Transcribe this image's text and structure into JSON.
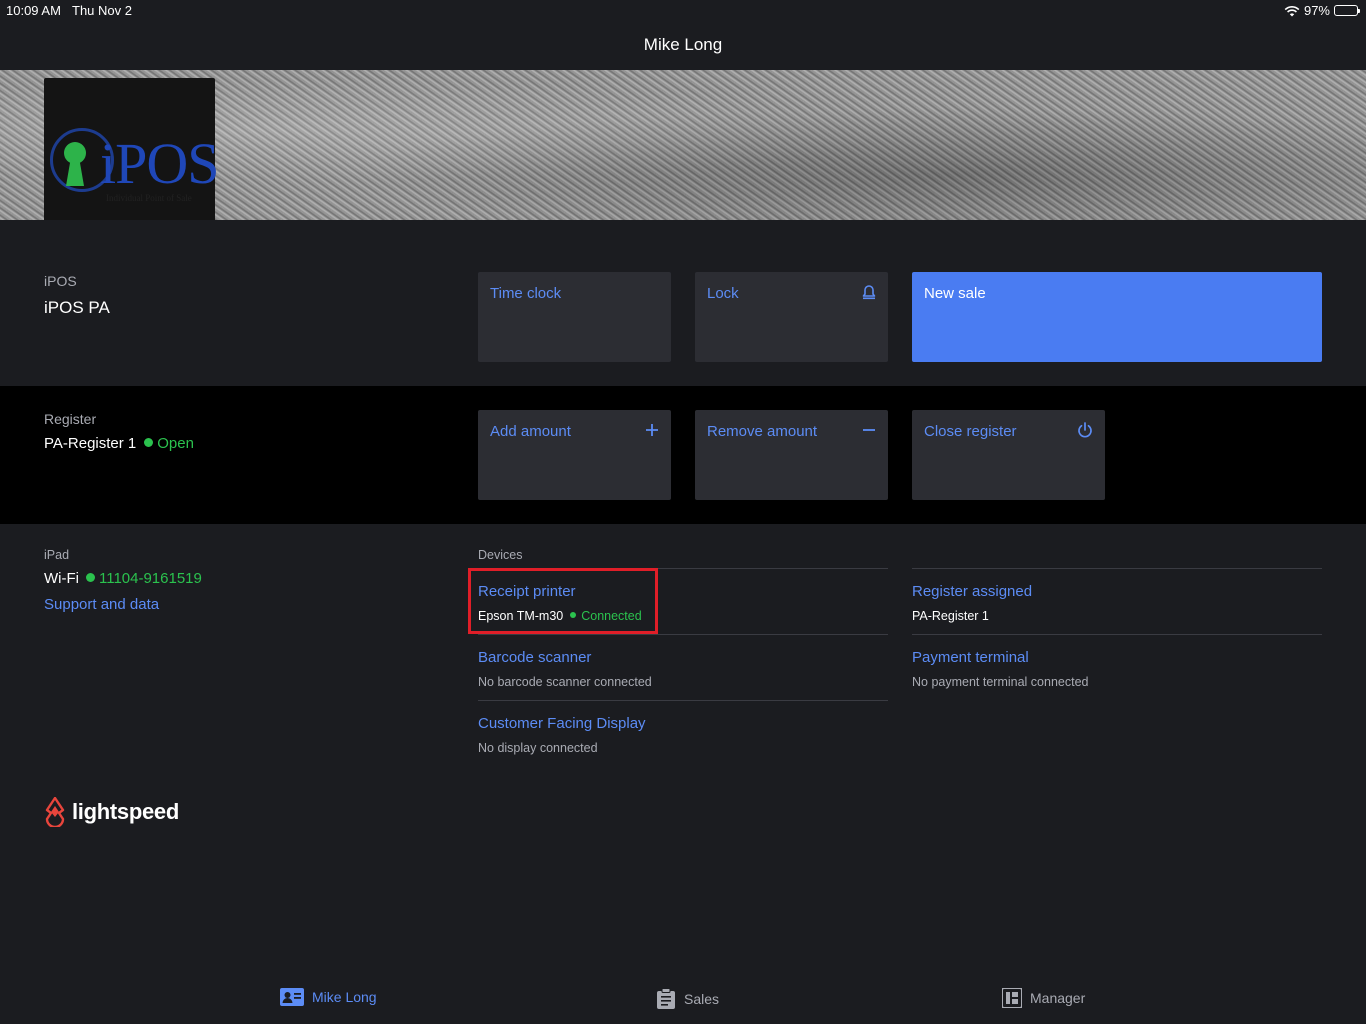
{
  "status_bar": {
    "time": "10:09 AM",
    "date": "Thu Nov 2",
    "battery": "97%",
    "battery_level": 0.97
  },
  "nav": {
    "title": "Mike Long"
  },
  "store": {
    "label": "iPOS",
    "name": "iPOS PA"
  },
  "logo": {
    "text": "iPOS",
    "subtitle": "Individual Point of Sale"
  },
  "actions_top": {
    "time_clock": "Time clock",
    "lock": "Lock",
    "new_sale": "New sale"
  },
  "register": {
    "label": "Register",
    "name": "PA-Register 1",
    "status": "Open",
    "add_amount": "Add amount",
    "remove_amount": "Remove amount",
    "close_register": "Close register"
  },
  "ipad": {
    "label": "iPad",
    "wifi_label": "Wi-Fi",
    "wifi_name": "11104-9161519",
    "support": "Support and data"
  },
  "devices": {
    "label": "Devices",
    "receipt_printer": {
      "title": "Receipt printer",
      "model": "Epson TM-m30",
      "status": "Connected"
    },
    "barcode_scanner": {
      "title": "Barcode scanner",
      "status": "No barcode scanner connected"
    },
    "customer_display": {
      "title": "Customer Facing Display",
      "status": "No display connected"
    },
    "register_assigned": {
      "title": "Register assigned",
      "value": "PA-Register 1"
    },
    "payment_terminal": {
      "title": "Payment terminal",
      "status": "No payment terminal connected"
    }
  },
  "brand": {
    "name": "lightspeed"
  },
  "tabs": [
    {
      "label": "Mike Long",
      "icon": "profile-card-icon",
      "active": true
    },
    {
      "label": "Sales",
      "icon": "clipboard-icon",
      "active": false
    },
    {
      "label": "Manager",
      "icon": "manager-icon",
      "active": false
    }
  ],
  "colors": {
    "accent": "#5c8cf5",
    "primary_button": "#4a7cf2",
    "success": "#2bc24e",
    "highlight": "#e01e28",
    "background": "#1b1c20"
  }
}
